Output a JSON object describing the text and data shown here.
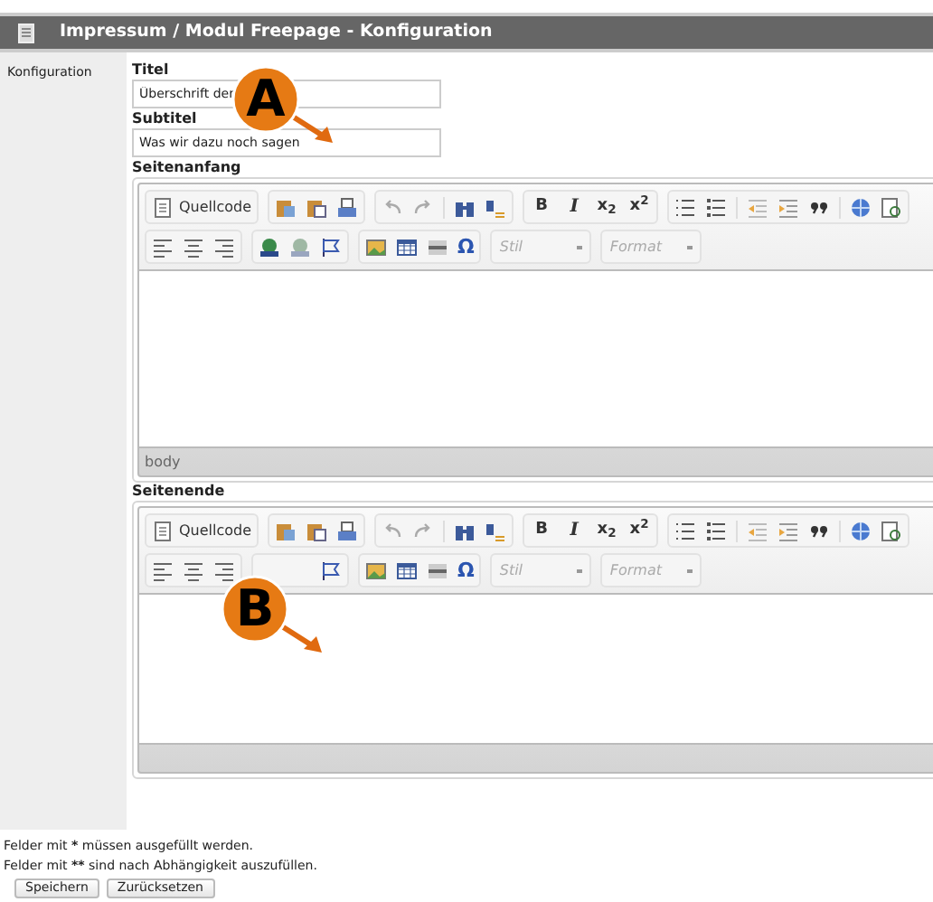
{
  "window": {
    "title": "Impressum / Modul Freepage - Konfiguration"
  },
  "sidebar": {
    "label": "Konfiguration"
  },
  "fields": [
    {
      "label": "Titel",
      "value": "Überschrift der"
    },
    {
      "label": "Subtitel",
      "value": "Was wir dazu noch sagen"
    }
  ],
  "editors": [
    {
      "label": "Seitenanfang",
      "source_button": "Quellcode",
      "format_buttons": [
        "B",
        "I",
        "x$_{2}$",
        "x$^{2}$"
      ],
      "special_char": "Ω",
      "style_select": "Stil",
      "format_select": "Format",
      "status_path": "body"
    },
    {
      "label": "Seitenende",
      "source_button": "Quellcode",
      "format_buttons": [
        "B",
        "I",
        "x$_{2}$",
        "x$^{2}$"
      ],
      "special_char": "Ω",
      "style_select": "Stil",
      "format_select": "Format"
    }
  ],
  "callouts": [
    {
      "letter": "A"
    },
    {
      "letter": "B"
    }
  ],
  "notes": [
    {
      "before": "Felder mit",
      "mark": "*",
      "after": "müssen ausgefüllt werden."
    },
    {
      "before": "Felder mit",
      "mark": "**",
      "after": "sind nach Abhängigkeit auszufüllen."
    }
  ],
  "buttons": [
    "Speichern",
    "Zurücksetzen"
  ]
}
